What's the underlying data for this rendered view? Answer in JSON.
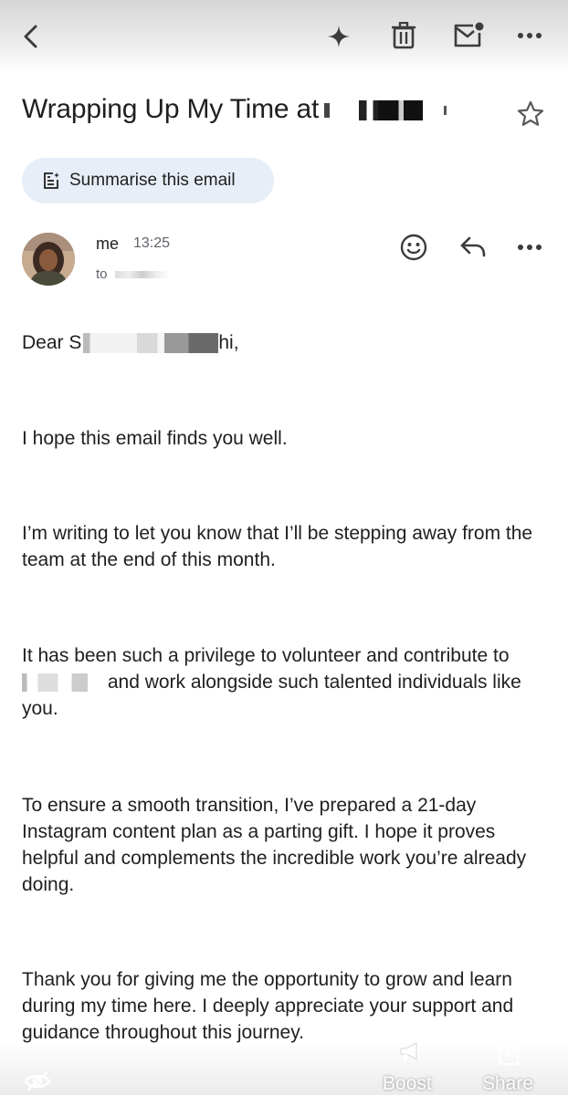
{
  "toolbar": {
    "back_icon": "back-arrow-icon",
    "gemini_icon": "sparkle-icon",
    "delete_icon": "trash-icon",
    "mark_unread_icon": "mark-unread-icon",
    "more_icon": "more-horizontal-icon"
  },
  "email": {
    "subject": "Wrapping Up My Time at",
    "summarise_label": "Summarise this email",
    "sender": "me",
    "time": "13:25",
    "to_label": "to",
    "greeting_prefix": "Dear S",
    "greeting_suffix": "hi,",
    "p1": "I hope this email finds you well.",
    "p2": "I’m writing to let you know that I’ll be stepping away from the team at the end of this month.",
    "p3_a": "It has been such a privilege to volunteer and contribute to",
    "p3_b": "and work alongside such talented individuals",
    "p3_c": "like you.",
    "p4": "To ensure a smooth transition, I’ve prepared a 21-day Instagram content plan as a parting gift. I hope it proves helpful and complements the incredible work you’re already doing.",
    "p5": "Thank you for giving me the opportunity to grow and learn during my time here. I deeply appreciate your support and guidance throughout this journey."
  },
  "overlay": {
    "boost_label": "Boost",
    "share_label": "Share"
  },
  "colors": {
    "text": "#1f1f1f",
    "secondary": "#5f6368",
    "summarise_bg": "#e8eef7"
  }
}
